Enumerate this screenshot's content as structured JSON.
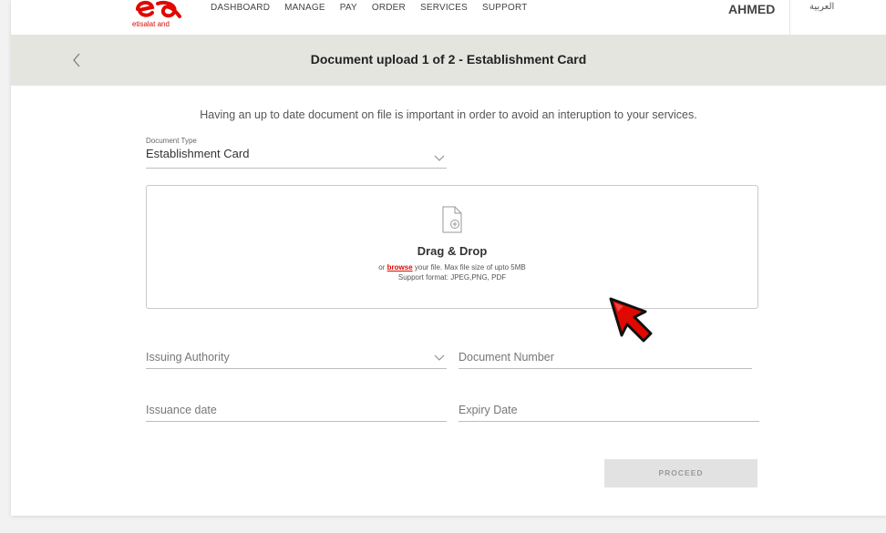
{
  "nav": {
    "logo_text": "etisalat and",
    "items": [
      {
        "label": "DASHBOARD"
      },
      {
        "label": "MANAGE"
      },
      {
        "label": "PAY"
      },
      {
        "label": "ORDER"
      },
      {
        "label": "SERVICES"
      },
      {
        "label": "SUPPORT"
      }
    ],
    "user_name": "AHMED",
    "language_link": "العربية"
  },
  "header": {
    "title": "Document upload 1 of 2 - Establishment Card"
  },
  "intro_text": "Having an up to date document on file is important in order to avoid an interuption to your services.",
  "document_type": {
    "label": "Document Type",
    "value": "Establishment Card"
  },
  "upload": {
    "title": "Drag & Drop",
    "hint_prefix": "or",
    "browse_label": "browse",
    "hint_suffix": "your file. Max file size of upto 5MB",
    "formats": "Support format: JPEG,PNG, PDF"
  },
  "fields": {
    "issuing_authority": "Issuing Authority",
    "document_number": "Document Number",
    "issuance_date": "Issuance date",
    "expiry_date": "Expiry Date"
  },
  "proceed_label": "PROCEED",
  "colors": {
    "brand": "#e00800",
    "header_band": "#e5e5e0",
    "disabled_button": "#e2e2e2"
  }
}
